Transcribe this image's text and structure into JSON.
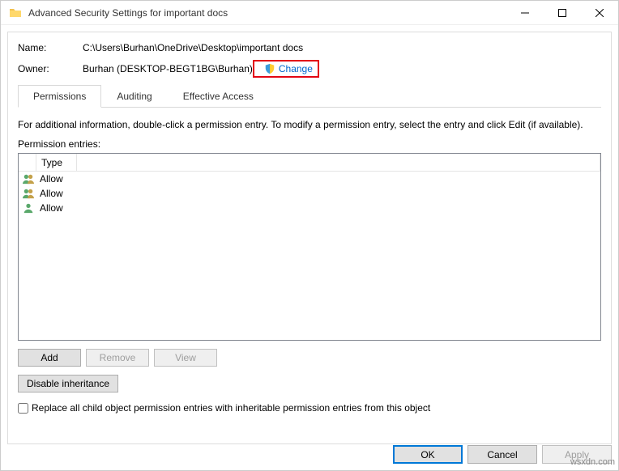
{
  "window": {
    "title": "Advanced Security Settings for important docs"
  },
  "fields": {
    "name_label": "Name:",
    "name_value": "C:\\Users\\Burhan\\OneDrive\\Desktop\\important docs",
    "owner_label": "Owner:",
    "owner_value": "Burhan (DESKTOP-BEGT1BG\\Burhan)",
    "change_label": "Change"
  },
  "tabs": {
    "permissions": "Permissions",
    "auditing": "Auditing",
    "effective": "Effective Access"
  },
  "info_text": "For additional information, double-click a permission entry. To modify a permission entry, select the entry and click Edit (if available).",
  "perm_label": "Permission entries:",
  "grid": {
    "col_type": "Type",
    "rows": [
      {
        "type": "Allow",
        "icon": "users"
      },
      {
        "type": "Allow",
        "icon": "users"
      },
      {
        "type": "Allow",
        "icon": "user"
      }
    ]
  },
  "buttons": {
    "add": "Add",
    "remove": "Remove",
    "view": "View",
    "disable_inheritance": "Disable inheritance",
    "replace_label": "Replace all child object permission entries with inheritable permission entries from this object"
  },
  "footer": {
    "ok": "OK",
    "cancel": "Cancel",
    "apply": "Apply"
  },
  "watermark": "wsxdn.com"
}
